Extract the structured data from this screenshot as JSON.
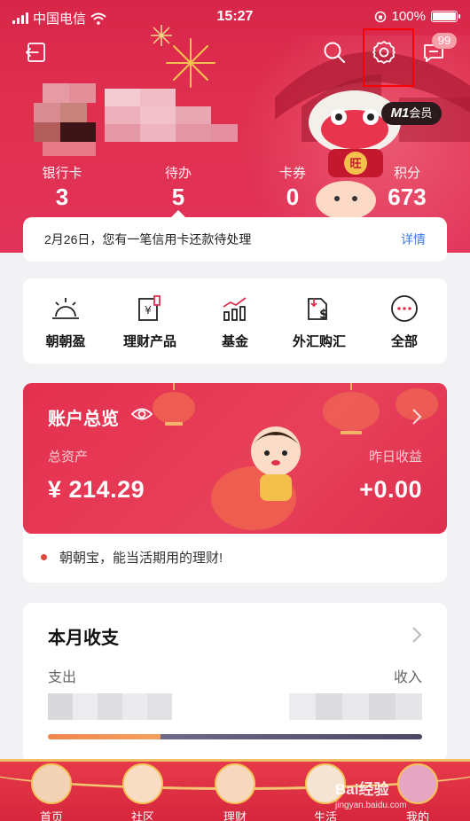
{
  "status_bar": {
    "carrier": "中国电信",
    "time": "15:27",
    "battery": "100%"
  },
  "header": {
    "message_badge": "99",
    "member_badge_prefix": "M1",
    "member_badge_suffix": "会员",
    "stats": [
      {
        "label": "银行卡",
        "value": "3"
      },
      {
        "label": "待办",
        "value": "5"
      },
      {
        "label": "卡券",
        "value": "0"
      },
      {
        "label": "积分",
        "value": "673"
      }
    ],
    "notice": {
      "text": "2月26日，您有一笔信用卡还款待处理",
      "link": "详情"
    }
  },
  "quick_menu": [
    {
      "label": "朝朝盈",
      "icon": "sunrise-icon"
    },
    {
      "label": "理财产品",
      "icon": "yen-document-icon"
    },
    {
      "label": "基金",
      "icon": "bar-trend-icon"
    },
    {
      "label": "外汇购汇",
      "icon": "dollar-exchange-icon"
    },
    {
      "label": "全部",
      "icon": "more-dots-icon"
    }
  ],
  "account": {
    "title": "账户总览",
    "total_label": "总资产",
    "total_value": "¥ 214.29",
    "yesterday_label": "昨日收益",
    "yesterday_value": "+0.00",
    "tip": "朝朝宝，能当活期用的理财!"
  },
  "monthly": {
    "title": "本月收支",
    "expense_label": "支出",
    "income_label": "收入",
    "expense_ratio": 0.3
  },
  "tabs": [
    {
      "label": "首页"
    },
    {
      "label": "社区"
    },
    {
      "label": "理财"
    },
    {
      "label": "生活"
    },
    {
      "label": "我的"
    }
  ],
  "watermark": {
    "title": "Bai经验",
    "url": "jingyan.baidu.com"
  },
  "colors": {
    "brand_red": "#e0304f",
    "link_blue": "#3a7be8",
    "highlight_red": "#ff0000"
  }
}
